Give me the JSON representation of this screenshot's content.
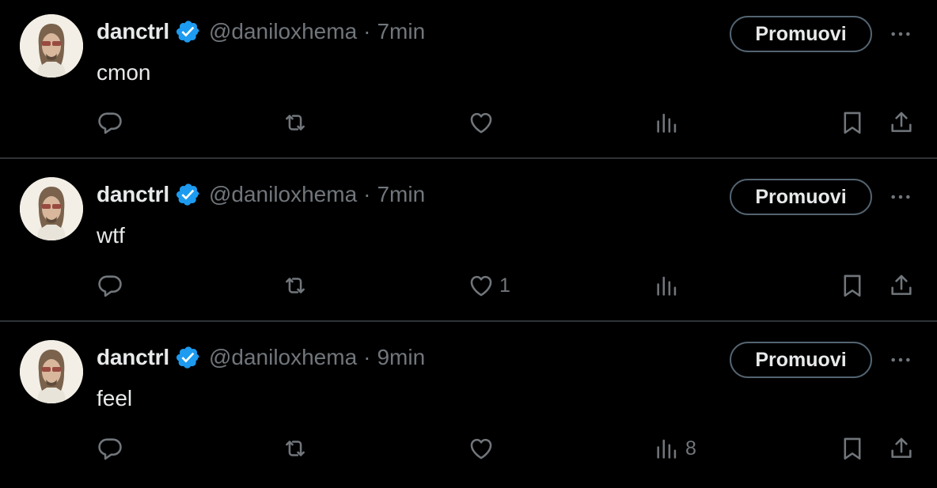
{
  "tweets": [
    {
      "author_name": "danctrl",
      "handle": "@daniloxhema",
      "separator": "·",
      "time": "7min",
      "text": "cmon",
      "promote_label": "Promuovi",
      "like_count": "",
      "views_count": ""
    },
    {
      "author_name": "danctrl",
      "handle": "@daniloxhema",
      "separator": "·",
      "time": "7min",
      "text": "wtf",
      "promote_label": "Promuovi",
      "like_count": "1",
      "views_count": ""
    },
    {
      "author_name": "danctrl",
      "handle": "@daniloxhema",
      "separator": "·",
      "time": "9min",
      "text": "feel",
      "promote_label": "Promuovi",
      "like_count": "",
      "views_count": "8"
    }
  ],
  "icons": {
    "verified": "verified-badge-icon",
    "more": "more-horizontal-icon",
    "reply": "reply-icon",
    "retweet": "retweet-icon",
    "like": "heart-icon",
    "views": "views-bar-chart-icon",
    "bookmark": "bookmark-icon",
    "share": "share-icon"
  },
  "colors": {
    "background": "#000000",
    "text": "#e7e9ea",
    "muted": "#71767b",
    "divider": "#2f3336",
    "verified": "#1d9bf0",
    "button_border": "#536471"
  }
}
